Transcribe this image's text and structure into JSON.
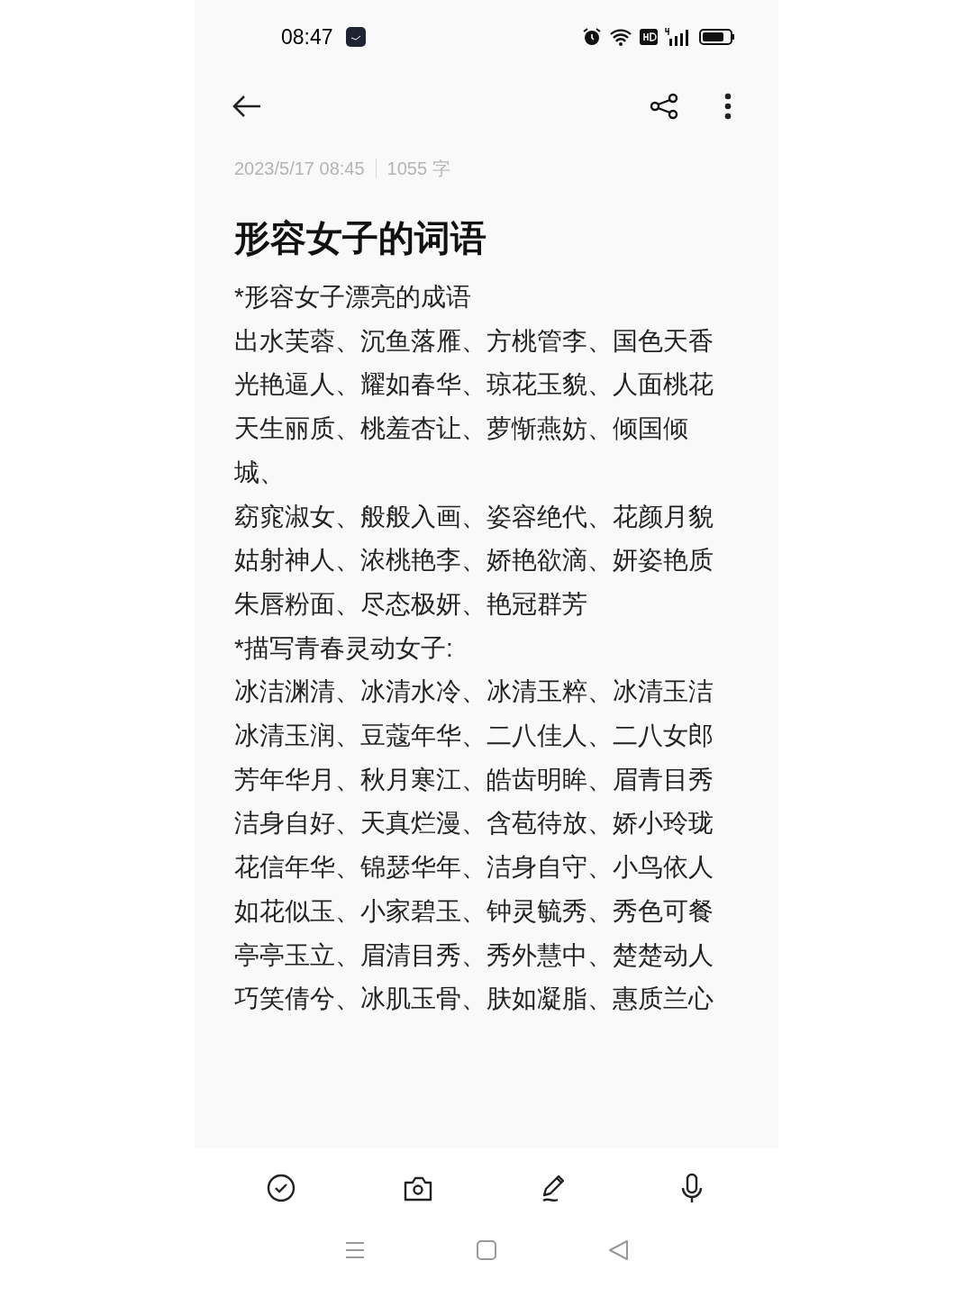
{
  "status_bar": {
    "time": "08:47"
  },
  "note": {
    "date": "2023/5/17 08:45",
    "word_count": "1055 字",
    "title": "形容女子的词语",
    "paragraphs": [
      "*形容女子漂亮的成语",
      "出水芙蓉、沉鱼落雁、方桃管李、国色天香",
      "光艳逼人、耀如春华、琼花玉貌、人面桃花",
      "天生丽质、桃羞杏让、萝惭燕妨、倾国倾城、",
      "窈窕淑女、般般入画、姿容绝代、花颜月貌",
      "姑射神人、浓桃艳李、娇艳欲滴、妍姿艳质",
      "朱唇粉面、尽态极妍、艳冠群芳",
      "*描写青春灵动女子:",
      "冰洁渊清、冰清水冷、冰清玉粹、冰清玉洁",
      "冰清玉润、豆蔻年华、二八佳人、二八女郎",
      "芳年华月、秋月寒江、皓齿明眸、眉青目秀",
      "洁身自好、天真烂漫、含苞待放、娇小玲珑",
      "花信年华、锦瑟华年、洁身自守、小鸟依人",
      "如花似玉、小家碧玉、钟灵毓秀、秀色可餐",
      "亭亭玉立、眉清目秀、秀外慧中、楚楚动人",
      "巧笑倩兮、冰肌玉骨、肤如凝脂、惠质兰心"
    ]
  },
  "toolbar": [
    {
      "kind": "checklist"
    },
    {
      "kind": "camera"
    },
    {
      "kind": "handwriting"
    },
    {
      "kind": "voice"
    }
  ],
  "nav_bar": [
    {
      "kind": "menu"
    },
    {
      "kind": "home"
    },
    {
      "kind": "back"
    }
  ]
}
